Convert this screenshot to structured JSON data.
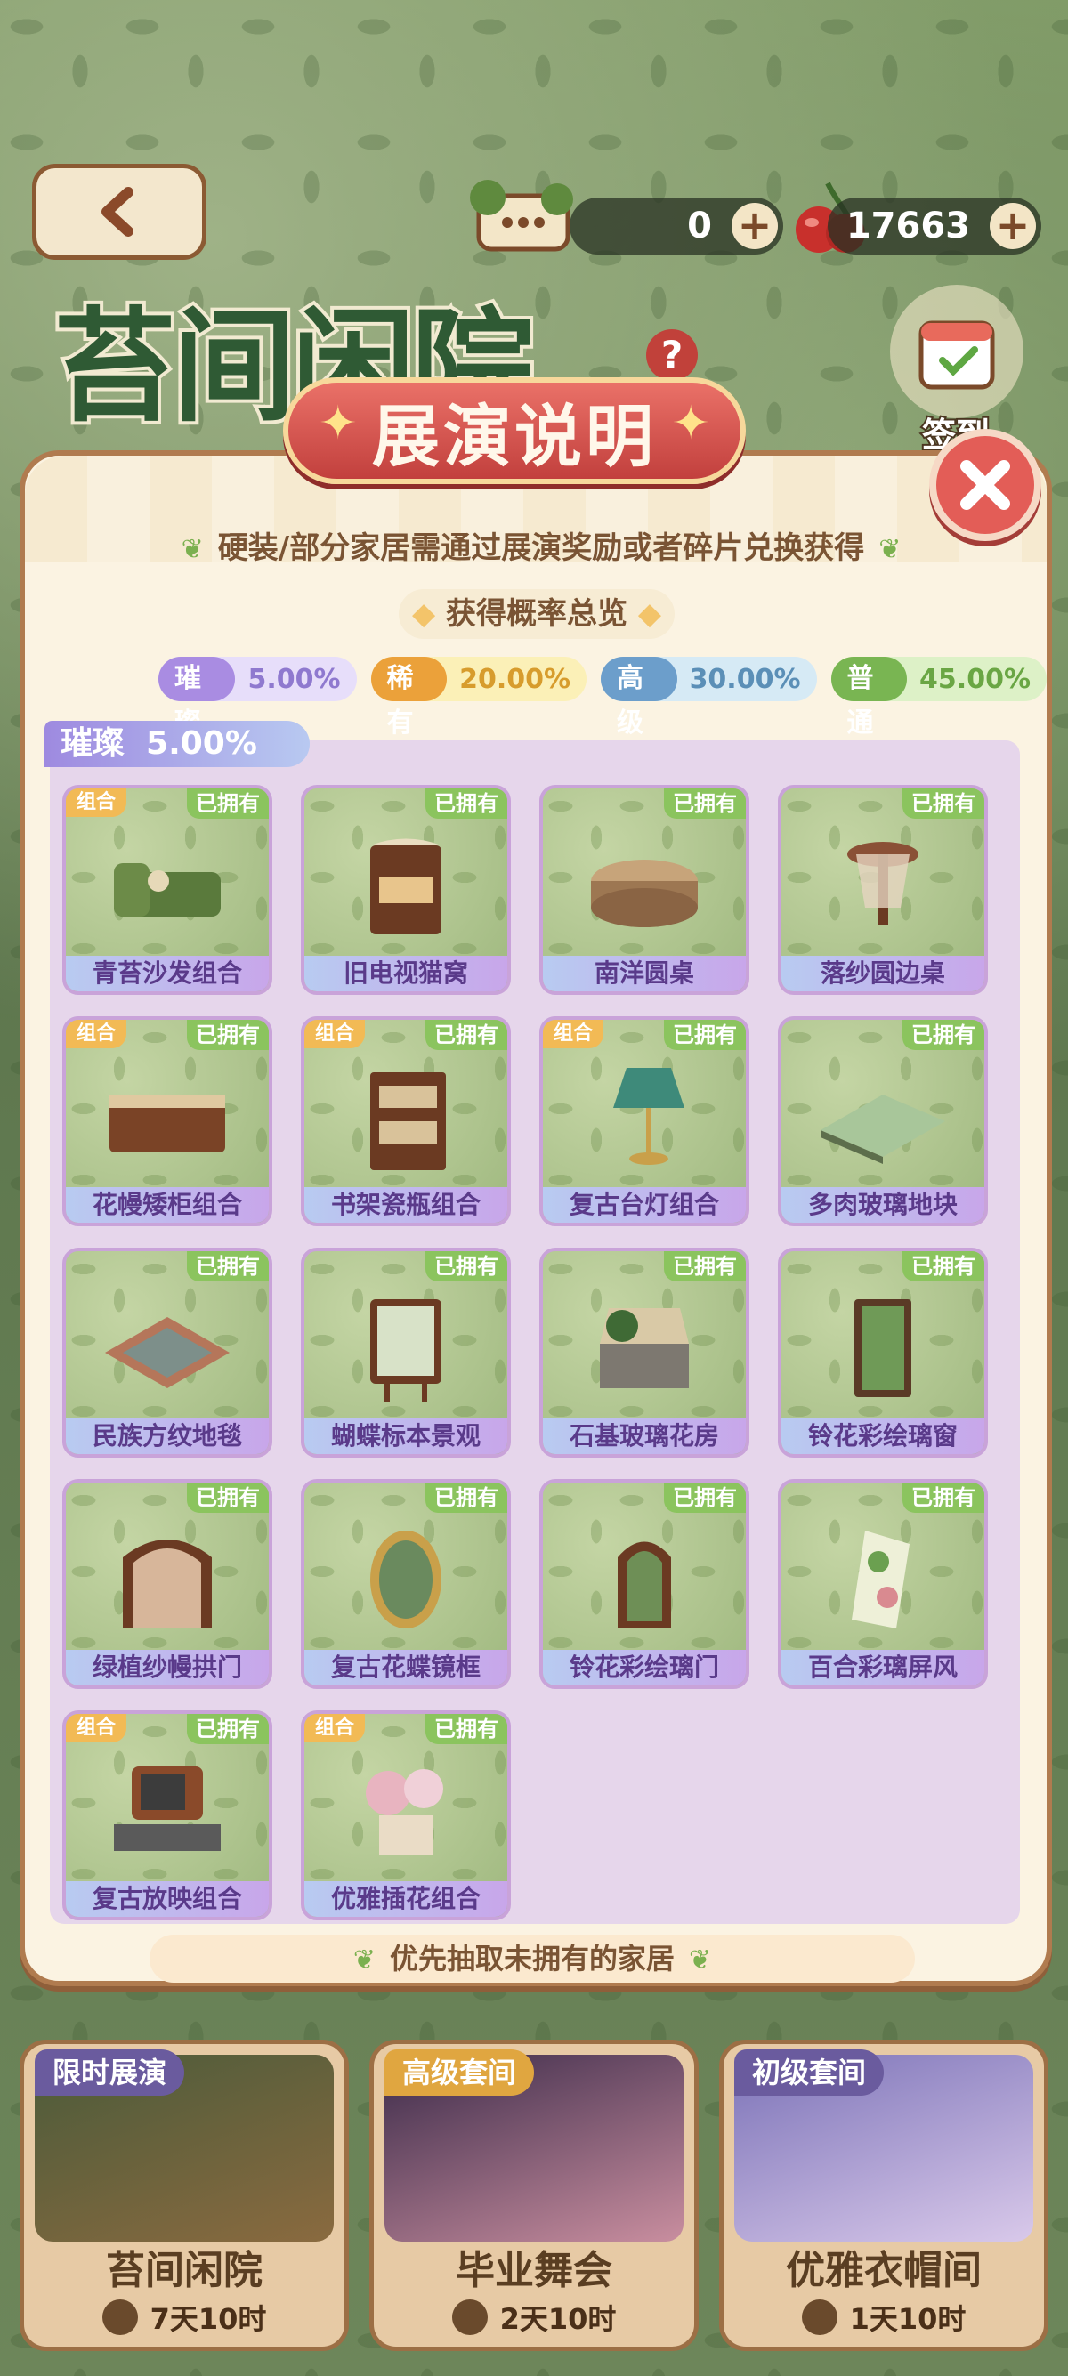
{
  "resources": [
    {
      "icon": "grass-box-icon",
      "value": "0"
    },
    {
      "icon": "cherry-icon",
      "value": "17663"
    }
  ],
  "header": {
    "title": "苔间闲院",
    "calendar_label": "签到"
  },
  "modal": {
    "title": "展演说明",
    "notice": "硬装/部分家居需通过展演奖励或者碎片兑换获得",
    "overview": "获得概率总览",
    "rates": [
      {
        "label": "璀璨",
        "pct": "5.00%"
      },
      {
        "label": "稀有",
        "pct": "20.00%"
      },
      {
        "label": "高级",
        "pct": "30.00%"
      },
      {
        "label": "普通",
        "pct": "45.00%"
      }
    ],
    "section": {
      "label": "璀璨",
      "pct": "5.00%"
    },
    "owned_label": "已拥有",
    "combo_label": "组合",
    "items": [
      {
        "name": "青苔沙发组合",
        "combo": true
      },
      {
        "name": "旧电视猫窝",
        "combo": false
      },
      {
        "name": "南洋圆桌",
        "combo": false
      },
      {
        "name": "落纱圆边桌",
        "combo": false
      },
      {
        "name": "花幔矮柜组合",
        "combo": true
      },
      {
        "name": "书架瓷瓶组合",
        "combo": true
      },
      {
        "name": "复古台灯组合",
        "combo": true
      },
      {
        "name": "多肉玻璃地块",
        "combo": false
      },
      {
        "name": "民族方纹地毯",
        "combo": false
      },
      {
        "name": "蝴蝶标本景观",
        "combo": false
      },
      {
        "name": "石基玻璃花房",
        "combo": false
      },
      {
        "name": "铃花彩绘璃窗",
        "combo": false
      },
      {
        "name": "绿植纱幔拱门",
        "combo": false
      },
      {
        "name": "复古花蝶镜框",
        "combo": false
      },
      {
        "name": "铃花彩绘璃门",
        "combo": false
      },
      {
        "name": "百合彩璃屏风",
        "combo": false
      },
      {
        "name": "复古放映组合",
        "combo": true
      },
      {
        "name": "优雅插花组合",
        "combo": true
      }
    ],
    "footer": "优先抽取未拥有的家居"
  },
  "packs": [
    {
      "tag": "限时展演",
      "name": "苔间闲院",
      "time": "7天10时",
      "color": "#6a5b9e"
    },
    {
      "tag": "高级套间",
      "name": "毕业舞会",
      "time": "2天10时",
      "color": "#e0a640"
    },
    {
      "tag": "初级套间",
      "name": "优雅衣帽间",
      "time": "1天10时",
      "color": "#6a5b9e"
    }
  ]
}
